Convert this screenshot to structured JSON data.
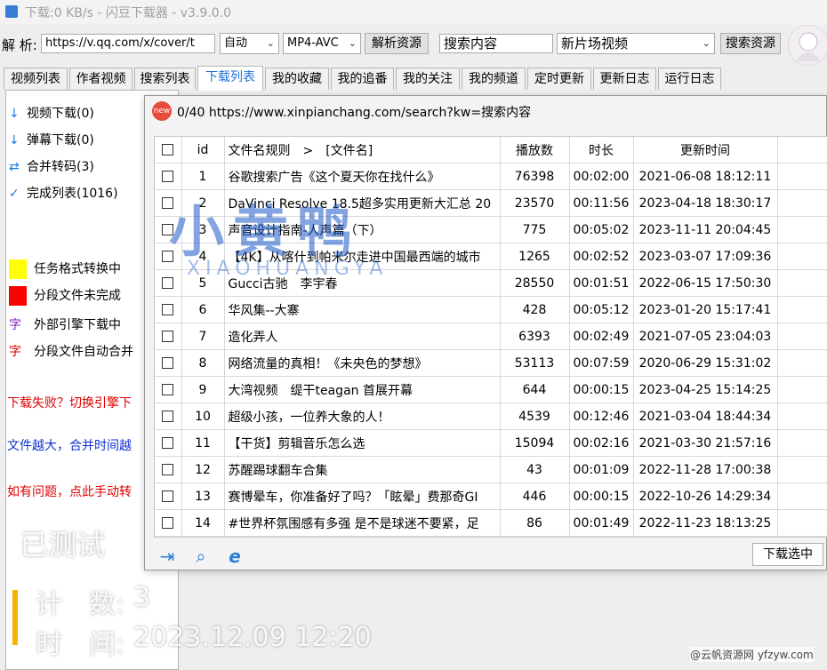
{
  "window": {
    "title": "下载:0 KB/s - 闪豆下载器 - v3.9.0.0"
  },
  "toolbar": {
    "parse_label": "解 析:",
    "url_value": "https://v.qq.com/x/cover/t",
    "mode_select": "自动",
    "format_select": "MP4-AVC",
    "parse_button": "解析资源",
    "search_content": "搜索内容",
    "category_select": "新片场视频",
    "search_button": "搜索资源"
  },
  "tabs": [
    "视频列表",
    "作者视频",
    "搜索列表",
    "下载列表",
    "我的收藏",
    "我的追番",
    "我的关注",
    "我的频道",
    "定时更新",
    "更新日志",
    "运行日志"
  ],
  "active_tab": "下载列表",
  "sidebar": {
    "items": [
      {
        "icon": "↓",
        "label": "视频下载(0)"
      },
      {
        "icon": "↓",
        "label": "弹幕下载(0)"
      },
      {
        "icon": "⇄",
        "label": "合并转码(3)"
      },
      {
        "icon": "✓",
        "label": "完成列表(1016)"
      }
    ],
    "legend": [
      {
        "label": "任务格式转换中",
        "color": "#ffff00"
      },
      {
        "label": "分段文件未完成",
        "color": "#ff0000"
      },
      {
        "glyph": "字",
        "glyph_color": "#8020c0",
        "label": "外部引擎下载中"
      },
      {
        "glyph": "字",
        "glyph_color": "#e00000",
        "label": "分段文件自动合并"
      }
    ],
    "notes": [
      {
        "text": "下载失败？切换引擎下",
        "color": "#e00000"
      },
      {
        "text": "文件越大，合并时间越",
        "color": "#1030d0"
      },
      {
        "text": "如有问题，点此手动转",
        "color": "#e00000"
      }
    ]
  },
  "overlay": {
    "tested": "已测试",
    "count_label": "计　数:",
    "count_value": "3",
    "time_label": "时　间:",
    "time_value": "2023.12.09 12:20",
    "site_watermark": "@云帆资源网 yfzyw.com",
    "logo_text": "小黄鸭",
    "logo_sub": "XIAOHUANGYA"
  },
  "dialog": {
    "badge": "new",
    "title": "0/40 https://www.xinpianchang.com/search?kw=搜索内容",
    "columns": [
      "id",
      "文件名规则　>　[文件名]",
      "播放数",
      "时长",
      "更新时间"
    ],
    "rows": [
      [
        "1",
        "谷歌搜索广告《这个夏天你在找什么》",
        "76398",
        "00:02:00",
        "2021-06-08 18:12:11"
      ],
      [
        "2",
        "DaVinci Resolve 18.5超多实用更新大汇总 20",
        "23570",
        "00:11:56",
        "2023-04-18 18:30:17"
      ],
      [
        "3",
        "声音设计指南-人声篇（下）",
        "775",
        "00:05:02",
        "2023-11-11 20:04:45"
      ],
      [
        "4",
        "【4K】从喀什到帕米尔走进中国最西端的城市",
        "1265",
        "00:02:52",
        "2023-03-07 17:09:36"
      ],
      [
        "5",
        "Gucci古驰　李宇春",
        "28550",
        "00:01:51",
        "2022-06-15 17:50:30"
      ],
      [
        "6",
        "华风集--大寨",
        "428",
        "00:05:12",
        "2023-01-20 15:17:41"
      ],
      [
        "7",
        "造化弄人",
        "6393",
        "00:02:49",
        "2021-07-05 23:04:03"
      ],
      [
        "8",
        "网络流量的真相！《未央色的梦想》",
        "53113",
        "00:07:59",
        "2020-06-29 15:31:02"
      ],
      [
        "9",
        "大湾视频　缇干teagan 首展开幕",
        "644",
        "00:00:15",
        "2023-04-25 15:14:25"
      ],
      [
        "10",
        "超级小孩，一位养大象的人！",
        "4539",
        "00:12:46",
        "2021-03-04 18:44:34"
      ],
      [
        "11",
        "【干货】剪辑音乐怎么选",
        "15094",
        "00:02:16",
        "2021-03-30 21:57:16"
      ],
      [
        "12",
        "苏醒踢球翻车合集",
        "43",
        "00:01:09",
        "2022-11-28 17:00:38"
      ],
      [
        "13",
        "赛博晕车，你准备好了吗？「眩晕」费那奇GI",
        "446",
        "00:00:15",
        "2022-10-26 14:29:34"
      ],
      [
        "14",
        "#世界杯氛围感有多强 是不是球迷不要紧，足",
        "86",
        "00:01:49",
        "2022-11-23 18:13:25"
      ]
    ],
    "download_button": "下载选中"
  }
}
